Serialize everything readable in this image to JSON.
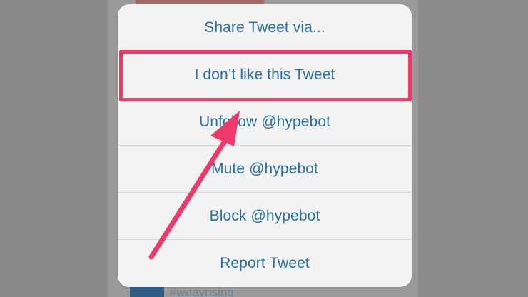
{
  "menu": {
    "items": [
      {
        "label": "Share Tweet via..."
      },
      {
        "label": "I don’t like this Tweet"
      },
      {
        "label": "Unfollow @hypebot"
      },
      {
        "label": "Mute @hypebot"
      },
      {
        "label": "Block @hypebot"
      },
      {
        "label": "Report Tweet"
      }
    ]
  },
  "underlay": {
    "hashtag": "#wdayrising"
  },
  "colors": {
    "menu_text": "#2a6fa1",
    "highlight": "#ee3a6b",
    "overlay": "#8f8f8f"
  },
  "icons": {
    "annotation": "arrow-icon"
  }
}
